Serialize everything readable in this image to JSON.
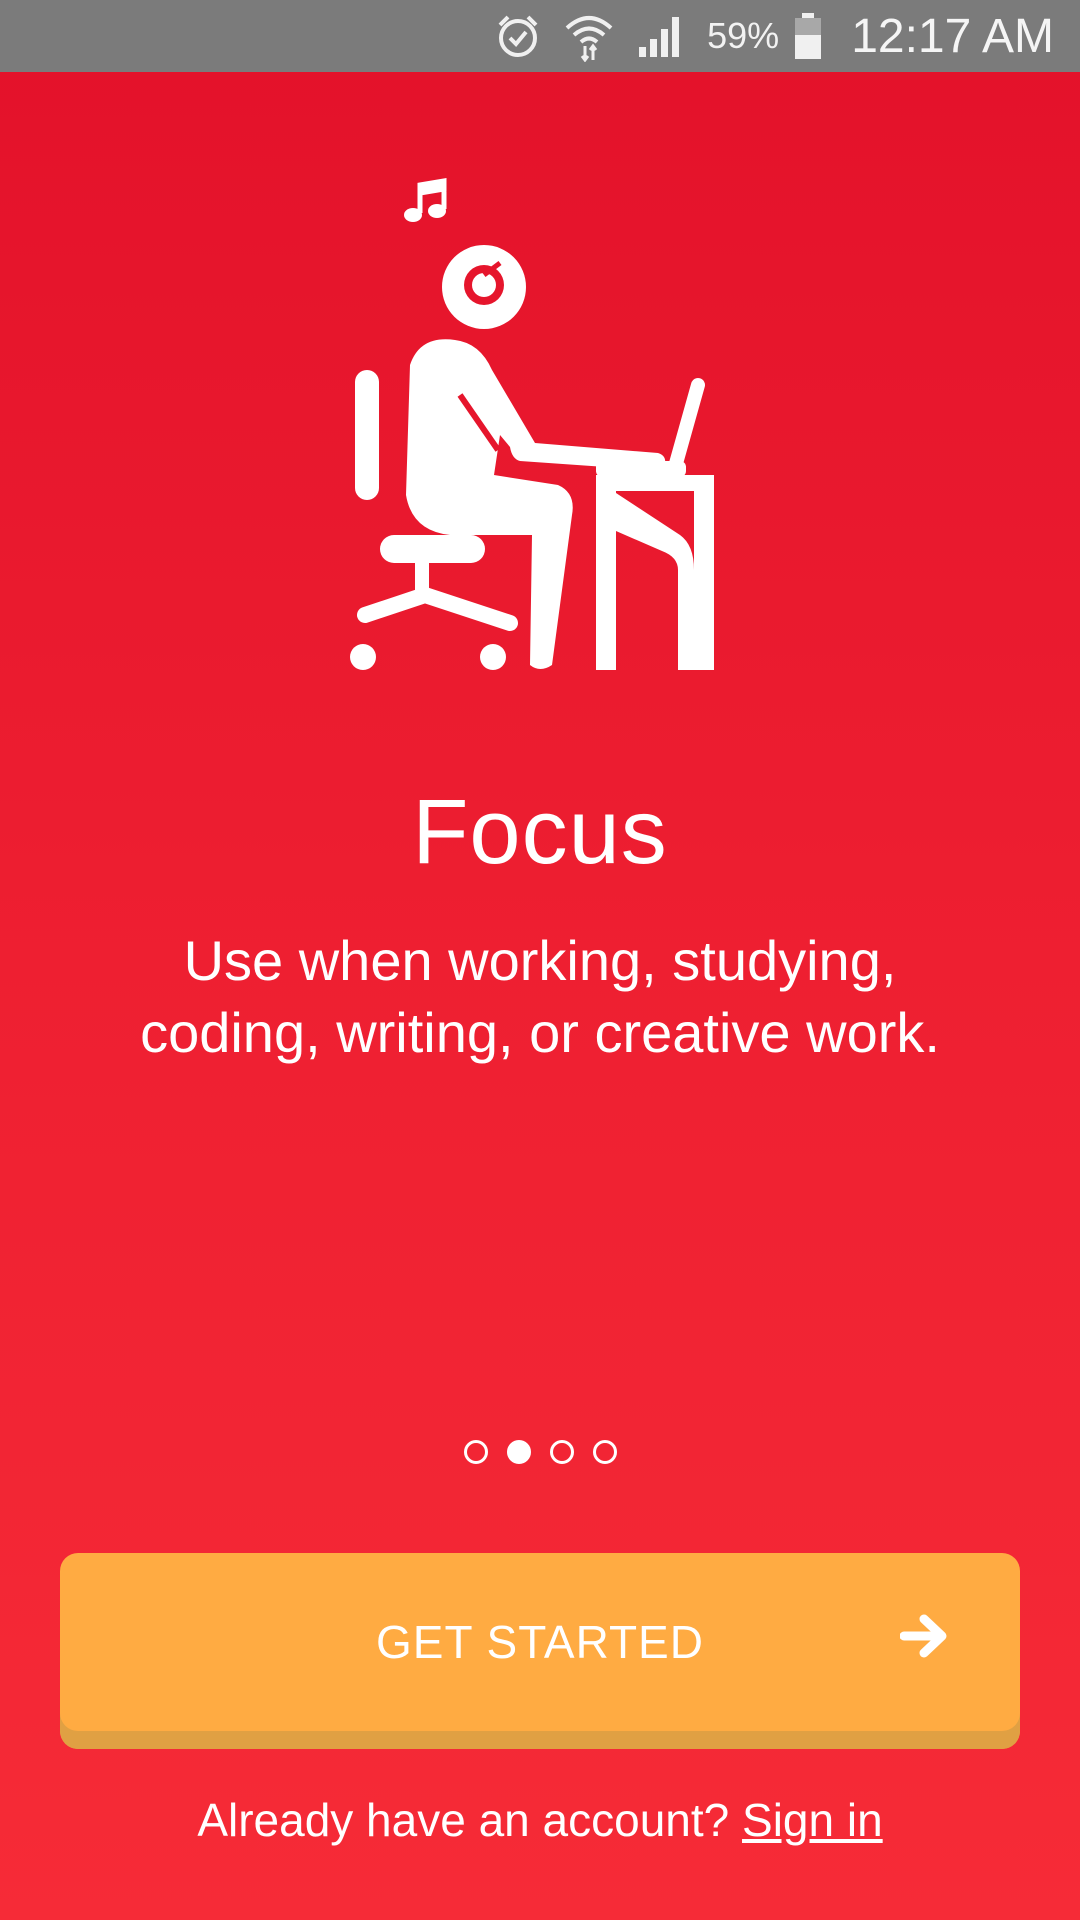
{
  "status_bar": {
    "battery_percent": "59%",
    "time": "12:17 AM",
    "icons": [
      "alarm-icon",
      "wifi-icon",
      "signal-icon",
      "battery-icon"
    ],
    "background": "#7b7b7b"
  },
  "onboarding": {
    "illustration": "person-at-desk-with-headphones-icon",
    "title": "Focus",
    "description": "Use when working, studying, coding, writing, or creative work.",
    "pager": {
      "total": 4,
      "active_index": 1
    }
  },
  "cta": {
    "label": "GET STARTED",
    "icon": "arrow-right-icon",
    "color": "#ffab42"
  },
  "footer": {
    "prompt": "Already have an account?",
    "link": "Sign in"
  },
  "theme": {
    "background_top": "#e3112a",
    "background_bottom": "#f62b37"
  }
}
